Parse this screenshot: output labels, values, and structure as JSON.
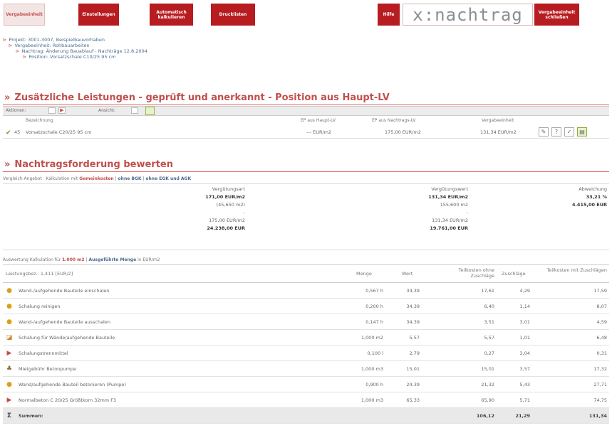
{
  "topnav": {
    "tabs": [
      "Vergabeeinheit",
      "Einstellungen",
      "Automatisch kalkulieren",
      "Drucklisten"
    ],
    "help": "Hilfe",
    "brand": "x:nachtrag",
    "close": "Vergabeeinheit schließen"
  },
  "tree": [
    "Projekt: 3001-3007, Beispielbauvorhaben",
    "Vergabeeinheit: Rohbauarbeiten",
    "Nachtrag: Änderung Bauablauf - Nachträge 12.8.2004",
    "Position: Vorsatzschale C10/25 95 cm"
  ],
  "section1": {
    "title": "Zusätzliche Leistungen - geprüft und anerkannt - Position aus Haupt-LV"
  },
  "toolbar1": {
    "actions_label": "Aktionen:",
    "search_label": "Ansicht:"
  },
  "position_table": {
    "headers": [
      "Bezeichnung",
      "EP aus Haupt-LV",
      "EP aus Nachtrags-LV",
      "Vergabeeinheit"
    ],
    "row": {
      "number": "45",
      "name": "Vorsatzschale C20/25 95 cm",
      "ep_haupt": "--- EUR/m2",
      "ep_nachtrag": "175,00 EUR/m2",
      "vergabe": "131,34 EUR/m2"
    }
  },
  "section2": {
    "title": "Nachtragsforderung bewerten"
  },
  "subnav": {
    "text": "Vergleich Angebot · Kalkulation mit",
    "link1": "Gemeinkosten",
    "sep": "|",
    "link2": "ohne BGK",
    "link3": "ohne EGK und AGK"
  },
  "comparison": {
    "col1": {
      "header": "Vergütungsart",
      "values": [
        "171,00 EUR/m2",
        "(45,650 m2)",
        "-",
        "175,00 EUR/m2",
        "24.238,00 EUR"
      ]
    },
    "col2": {
      "header": "Vergütungswert",
      "values": [
        "131,34 EUR/m2",
        "155,600 m2",
        "-",
        "131,34 EUR/m2",
        "19.761,00 EUR"
      ]
    },
    "col3": {
      "header": "Abweichung",
      "values": [
        "33,21 %",
        "",
        "",
        "",
        "4.415,00 EUR"
      ]
    }
  },
  "calc_nav": {
    "text": "Auswertung Kalkulation für",
    "qty": "1.000 m2",
    "link": "Ausgeführte Menge",
    "unit": "in EUR/m2"
  },
  "calc_table": {
    "headers": [
      "Leistungsbez.: 1,411 [EUR/2]",
      "Menge",
      "Wert",
      "Teilkosten ohne Zuschläge",
      "Zuschläge",
      "Teilkosten mit Zuschlägen"
    ],
    "rows": [
      {
        "icon": "●",
        "name": "Wand-/aufgehende Bauteile einschalen",
        "menge": "0,567 h",
        "wert": "34,39",
        "ohne": "17,61",
        "zus": "4,29",
        "mit": "17,59"
      },
      {
        "icon": "●",
        "name": "Schalung reinigen",
        "menge": "0,200 h",
        "wert": "34,39",
        "ohne": "6,40",
        "zus": "1,14",
        "mit": "8,07"
      },
      {
        "icon": "●",
        "name": "Wand-/aufgehende Bauteile ausschalen",
        "menge": "0,147 h",
        "wert": "34,39",
        "ohne": "3,51",
        "zus": "3,01",
        "mit": "4,59"
      },
      {
        "icon": "◪",
        "name": "Schalung für Wände/aufgehende Bauteile",
        "menge": "1,000 m2",
        "wert": "5,57",
        "ohne": "5,57",
        "zus": "1,01",
        "mit": "6,48"
      },
      {
        "icon": "▶",
        "name": "Schalungstrennmittel",
        "menge": "0,100 l",
        "wert": "2,79",
        "ohne": "0,27",
        "zus": "3,04",
        "mit": "0,31"
      },
      {
        "icon": "♣",
        "name": "Mietgebühr Betonpumpe",
        "menge": "1,000 m3",
        "wert": "15,01",
        "ohne": "15,01",
        "zus": "3,57",
        "mit": "17,32"
      },
      {
        "icon": "●",
        "name": "Wand/aufgehende Bauteil betonieren (Pumpe)",
        "menge": "0,900 h",
        "wert": "24,39",
        "ohne": "21,32",
        "zus": "5,43",
        "mit": "27,71"
      },
      {
        "icon": "▶",
        "name": "Normalbeton C 20/25 Größtkorn 32mm F3",
        "menge": "1,000 m3",
        "wert": "65,33",
        "ohne": "65,90",
        "zus": "5,71",
        "mit": "74,75"
      },
      {
        "icon": "Σ",
        "name": "Summen:",
        "menge": "",
        "wert": "",
        "ohne": "106,12",
        "zus": "21,29",
        "mit": "131,34"
      }
    ]
  },
  "colors": {
    "accent": "#b71c20",
    "brand_gray": "#8a8f96"
  }
}
